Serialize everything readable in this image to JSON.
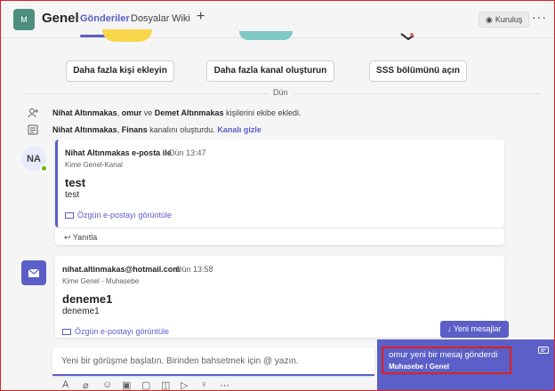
{
  "header": {
    "team_initial": "M",
    "channel_name": "Genel",
    "tabs": [
      {
        "label": "Gönderiler",
        "active": true
      },
      {
        "label": "Dosyalar",
        "active": false
      },
      {
        "label": "Wiki",
        "active": false
      }
    ],
    "add_tab": "+",
    "install_label": "Kuruluş",
    "more": "···"
  },
  "welcome_actions": [
    {
      "label": "Daha fazla kişi ekleyin"
    },
    {
      "label": "Daha fazla kanal oluşturun"
    },
    {
      "label": "SSS bölümünü açın"
    }
  ],
  "date_separator": "Dün",
  "system_messages": [
    {
      "name1": "Nihat Altınmakas",
      "sep1": ",",
      "name2": "omur",
      "sep2": "ve",
      "name3": "Demet Altınmakas",
      "rest": "kişilerini ekibe ekledi."
    },
    {
      "name1": "Nihat Altınmakas",
      "sep1": ",",
      "name2": "Finans",
      "rest": "kanalını oluşturdu.",
      "link": "Kanalı gizle"
    }
  ],
  "messages": [
    {
      "avatar_initials": "NA",
      "sender": "Nihat Altınmakas e-posta ile",
      "time": "Dün 13:47",
      "to": "Kime Genel-Kanal",
      "subject": "test",
      "body": "test",
      "view_email": "Özgün e-postayı görüntüle",
      "reply": "Yanıtla"
    },
    {
      "sender": "nihat.altinmakas@hotmail.com",
      "time": "Dün 13:58",
      "to": "Kime Genel - Muhasebe",
      "subject": "deneme1",
      "body": "deneme1",
      "view_email": "Özgün e-postayı görüntüle"
    }
  ],
  "new_messages_label": "Yeni mesajlar",
  "compose": {
    "placeholder": "Yeni bir görüşme başlatın. Birinden bahsetmek için @ yazın."
  },
  "toast": {
    "title": "omur yeni bir mesaj gönderdi",
    "subtitle": "Muhasebe / Genel"
  },
  "colors": {
    "accent": "#5b5fc7",
    "highlight": "#e02020",
    "presence": "#6bb700"
  }
}
